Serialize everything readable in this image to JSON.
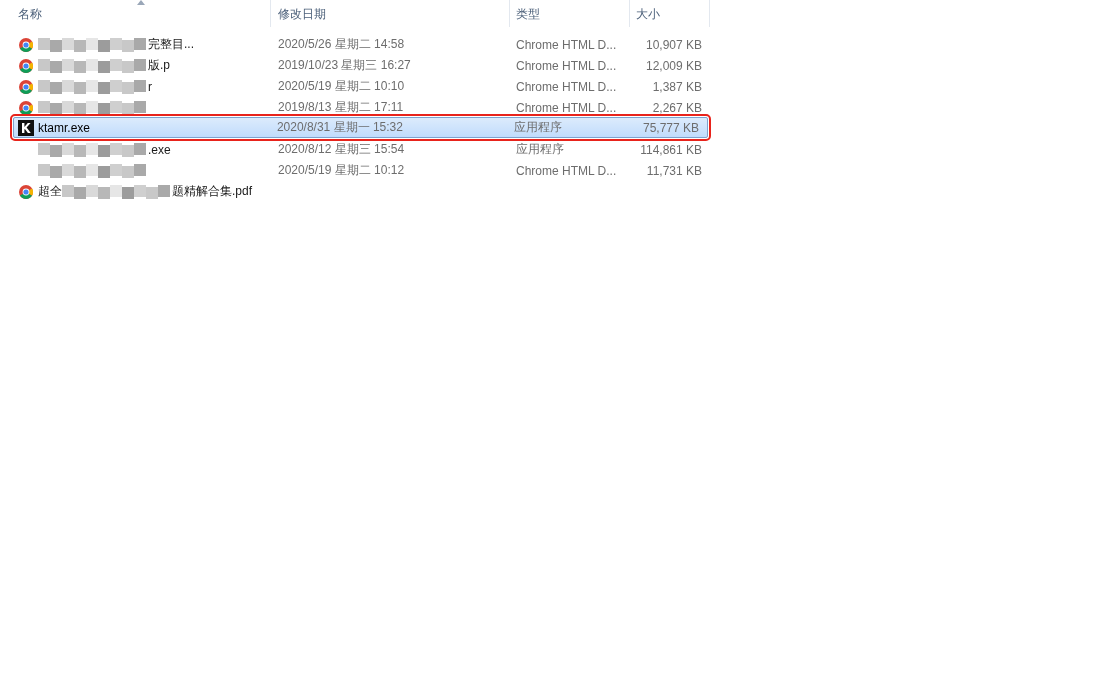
{
  "columns": [
    {
      "label": "名称",
      "sorted": true
    },
    {
      "label": "修改日期",
      "sorted": false
    },
    {
      "label": "类型",
      "sorted": false
    },
    {
      "label": "大小",
      "sorted": false
    }
  ],
  "rows": [
    {
      "kind": "document",
      "name": "完整目...",
      "redacted": true,
      "date": "2020/5/26 星期二 14:58",
      "type": "Chrome HTML D...",
      "size": "10,907 KB",
      "selected": false
    },
    {
      "kind": "document",
      "name": "版.p",
      "redacted": true,
      "date": "2019/10/23 星期三 16:27",
      "type": "Chrome HTML D...",
      "size": "12,009 KB",
      "selected": false
    },
    {
      "kind": "document",
      "name": "r",
      "redacted": true,
      "date": "2020/5/19 星期二 10:10",
      "type": "Chrome HTML D...",
      "size": "1,387 KB",
      "selected": false
    },
    {
      "kind": "document",
      "redacted": true,
      "date": "2019/8/13 星期二 17:11",
      "type": "Chrome HTML D...",
      "size": "2,267 KB",
      "selected": false
    },
    {
      "kind": "program",
      "name": "ktamr.exe",
      "redacted": false,
      "date": "2020/8/31 星期一 15:32",
      "type": "应用程序",
      "size": "75,777 KB",
      "selected": true
    },
    {
      "kind": "hidden",
      "name": ".exe",
      "redacted": true,
      "date": "2020/8/12 星期三 15:54",
      "type": "应用程序",
      "size": "114,861 KB",
      "selected": false
    },
    {
      "kind": "hidden",
      "redacted": true,
      "date": "2020/5/19 星期二 10:12",
      "type": "Chrome HTML D...",
      "size": "11,731 KB",
      "selected": false
    },
    {
      "kind": "document",
      "name": "超全",
      "name_end": "题精解合集.pdf",
      "redacted": true,
      "selected": false
    }
  ]
}
